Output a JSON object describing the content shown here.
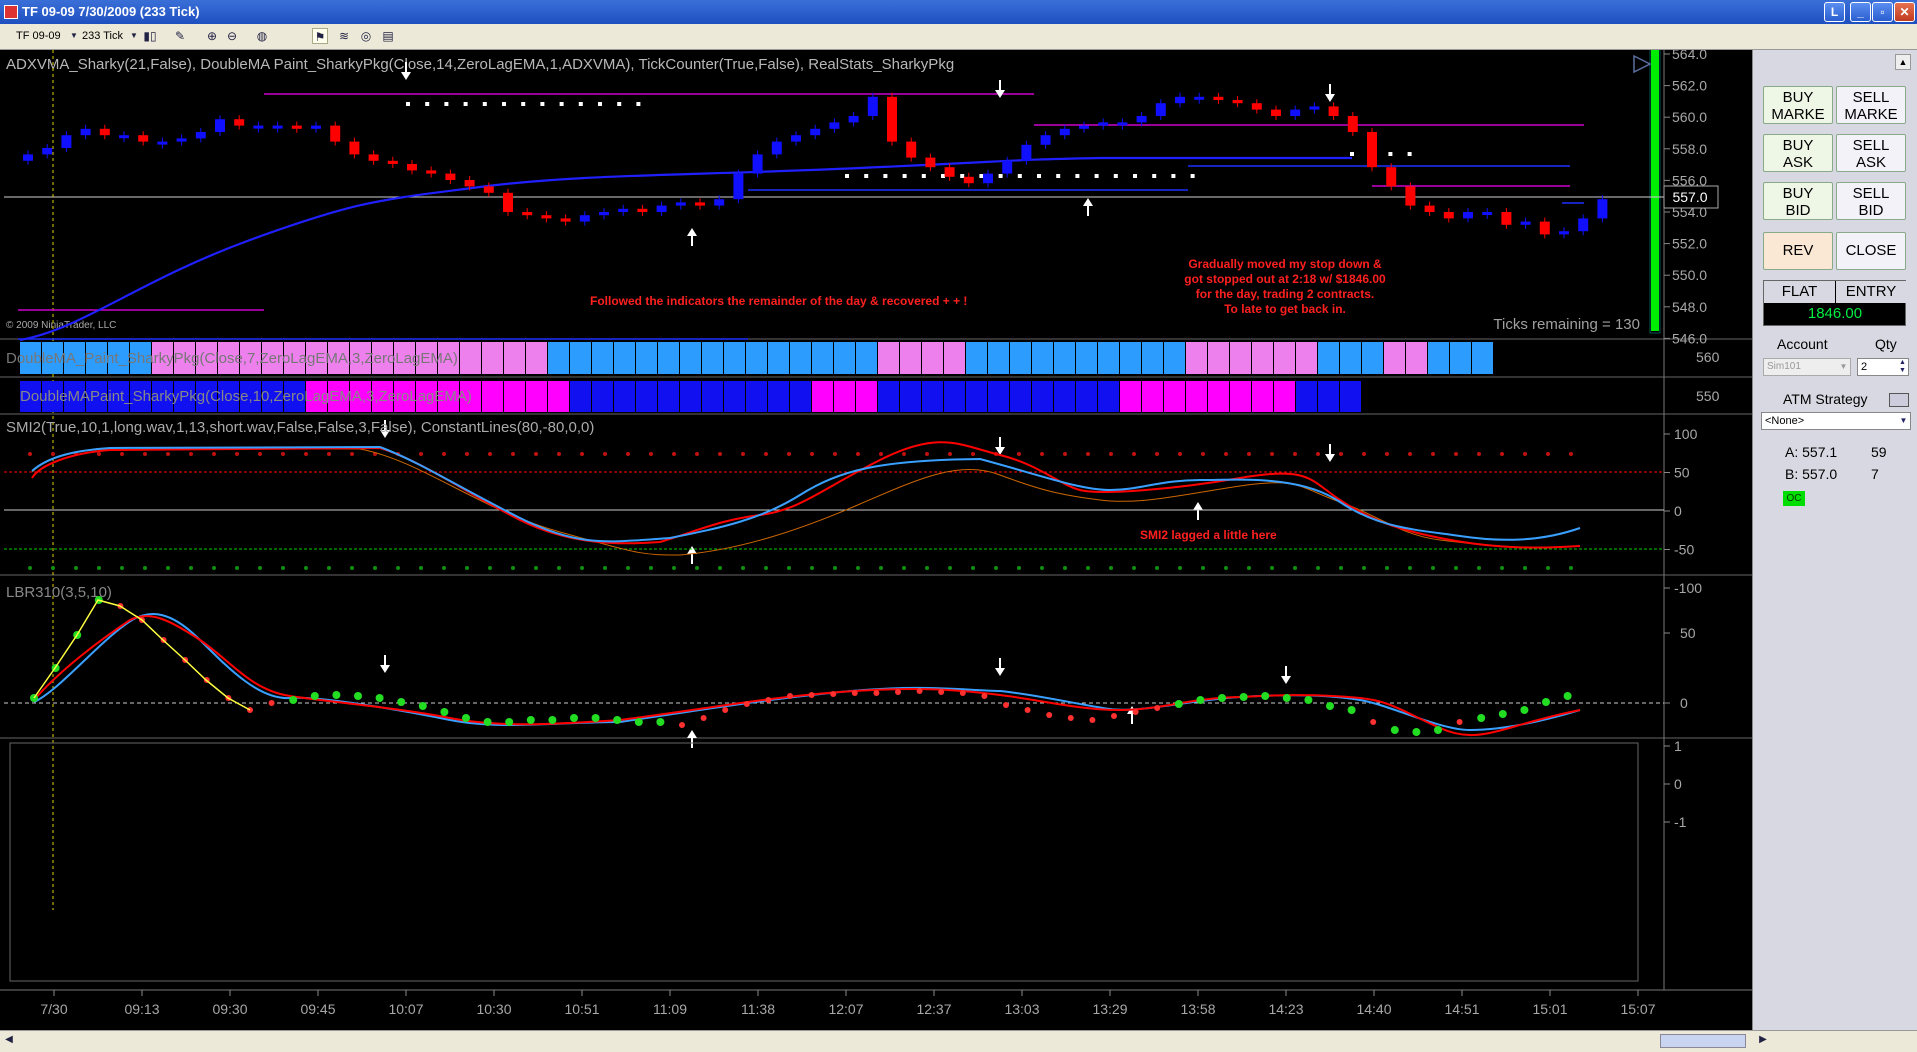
{
  "window": {
    "title": "TF 09-09  7/30/2009 (233 Tick)",
    "buttons": [
      "L",
      "_",
      "▫",
      "✕"
    ]
  },
  "toolbar": {
    "instrument": "TF 09-09",
    "interval": "233 Tick"
  },
  "chart": {
    "price_panel": {
      "indicators_label": "ADXVMA_Sharky(21,False),  DoubleMA  Paint_SharkyPkg(Close,14,ZeroLagEMA,1,ADXVMA),  TickCounter(True,False),  RealStats_SharkyPkg",
      "copyright": "© 2009 NinjaTrader, LLC",
      "ticks_remaining": "Ticks remaining = 130",
      "last_price": "557.0",
      "yaxis_labels": [
        "564.0",
        "562.0",
        "560.0",
        "558.0",
        "556.0",
        "554.0",
        "552.0",
        "550.0",
        "548.0",
        "546.0"
      ],
      "annotation_1": "Followed the indicators the remainder of the day & recovered + + !",
      "annotation_2_lines": [
        "Gradually moved my stop down &",
        "got stopped out at 2:18 w/ $1846.00",
        "for the day, trading 2 contracts.",
        "To late to get back in."
      ]
    },
    "paint_panel_1": {
      "label": "DoubleMA_Paint_SharkyPkg(Close,7,ZeroLagEMA,3,ZeroLagEMA)",
      "yaxis_label": "560"
    },
    "paint_panel_2": {
      "label": "DoubleMAPaint_SharkyPkg(Close,10,ZeroLagEMA,3,ZeroLagEMA)",
      "yaxis_label": "550"
    },
    "smi_panel": {
      "label": "SMI2(True,10,1,long.wav,1,13,short.wav,False,False,3,False),  ConstantLines(80,-80,0,0)",
      "annotation": "SMI2 lagged a little here",
      "yaxis_labels": [
        "100",
        "50",
        "0",
        "-50",
        "-100"
      ]
    },
    "lbr_panel": {
      "label": "LBR310(3,5,10)",
      "yaxis_labels": [
        "50",
        "0"
      ]
    },
    "empty_panel": {
      "yaxis_labels": [
        "1",
        "0",
        "-1"
      ]
    },
    "xaxis_labels": [
      "7/30",
      "09:13",
      "09:30",
      "09:45",
      "10:07",
      "10:30",
      "10:51",
      "11:09",
      "11:38",
      "12:07",
      "12:37",
      "13:03",
      "13:29",
      "13:58",
      "14:23",
      "14:40",
      "14:51",
      "15:01",
      "15:07"
    ],
    "colors": {
      "up_candle": "#1010ff",
      "down_candle": "#ff0000",
      "adxvma_line": "#2020ff",
      "magenta_level": "#cc00cc",
      "smi_fast": "#3aa0ff",
      "smi_slow": "#ff0000",
      "lbr_fast": "#ffff40",
      "lbr_dots": "#22dd22",
      "paint_cyan": "#2c9cff",
      "paint_violet": "#ee80ee",
      "paint_blue": "#1010f0",
      "paint_magenta": "#ff00ff",
      "annotation": "#ff2020",
      "tick_progress": "#00ee00"
    }
  },
  "side_panel": {
    "buttons": {
      "buy_market": "BUY\nMARKE",
      "sell_market": "SELL\nMARKE",
      "buy_ask": "BUY\nASK",
      "sell_ask": "SELL\nASK",
      "buy_bid": "BUY\nBID",
      "sell_bid": "SELL\nBID",
      "rev": "REV",
      "close": "CLOSE"
    },
    "position": {
      "status": "FLAT",
      "entry_label": "ENTRY",
      "pnl": "1846.00"
    },
    "account_label": "Account",
    "qty_label": "Qty",
    "account_value": "Sim101",
    "qty_value": "2",
    "atm_label": "ATM Strategy",
    "atm_value": "<None>",
    "ask_label": "A: 557.1",
    "ask_size": "59",
    "bid_label": "B: 557.0",
    "bid_size": "7",
    "oc_badge": "OC"
  }
}
